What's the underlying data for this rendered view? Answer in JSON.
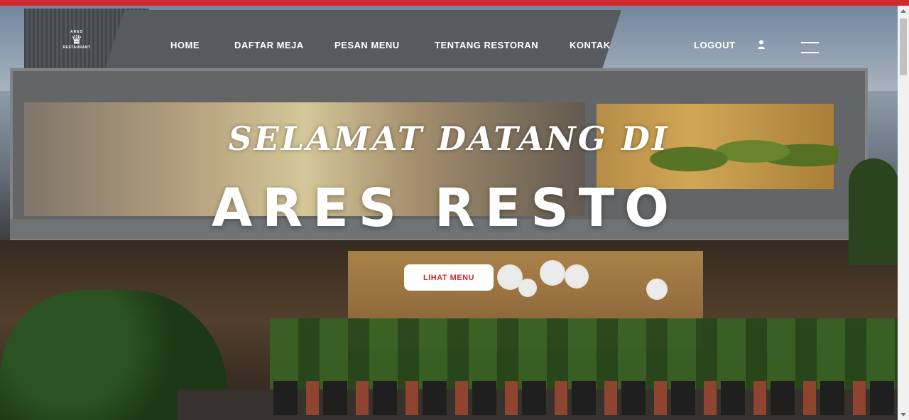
{
  "logo": {
    "top": "ARES",
    "bottom": "RESTAURANT"
  },
  "nav": {
    "items": [
      "HOME",
      "DAFTAR MEJA",
      "PESAN MENU",
      "TENTANG RESTORAN",
      "KONTAK"
    ],
    "logout": "LOGOUT"
  },
  "icons": {
    "user": "user-icon",
    "menu": "hamburger-menu-icon"
  },
  "hero": {
    "welcome": "SELAMAT DATANG DI",
    "brand": "ARES RESTO",
    "cta": "LIHAT MENU"
  },
  "colors": {
    "accent": "#cf2a2e",
    "text": "#ffffff"
  }
}
